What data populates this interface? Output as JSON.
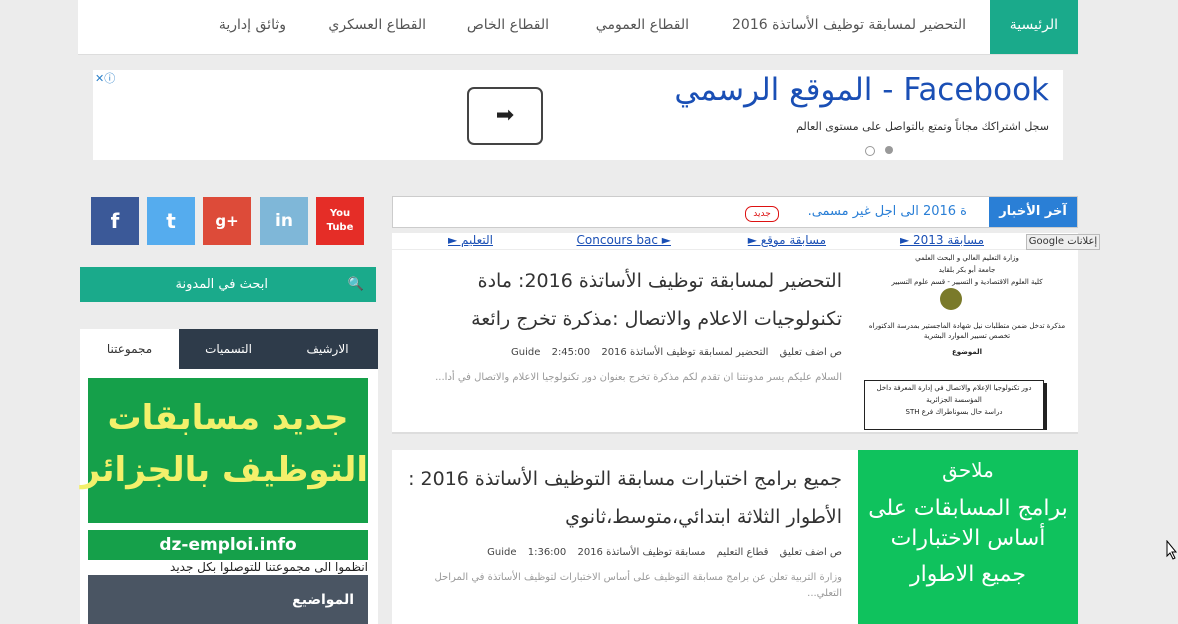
{
  "nav": {
    "home": "الرئيسية",
    "items": [
      "التحضير لمسابقة توظيف الأساتذة 2016",
      "القطاع العمومي",
      "القطاع الخاص",
      "القطاع العسكري",
      "وثائق إدارية"
    ]
  },
  "ad": {
    "title": "Facebook - الموقع الرسمي",
    "subtitle": "سجل اشتراكك مجاناً وتمتع بالتواصل على مستوى العالم",
    "arrow": "➡"
  },
  "social": {
    "facebook": "f",
    "twitter": "t",
    "gplus": "g+",
    "linkedin": "in",
    "youtube": "You Tube"
  },
  "search": {
    "label": "ابحث في المدونة"
  },
  "tabs": {
    "group": "مجموعتنا",
    "labels": "التسميات",
    "archive": "الارشيف"
  },
  "sidebar": {
    "image_line1": "جديد مسابقات",
    "image_line2": "التوظيف بالجزائر",
    "url": "dz-emploi.info",
    "join": "انظموا الى مجموعتنا للتوصلوا بكل جديد",
    "topics": "المواضيع"
  },
  "news": {
    "label": "آخر الأخبار",
    "text": "ة 2016 الى اجل غير مسمى.",
    "badge": "جديد"
  },
  "links": [
    "مسابقة 2013 ►",
    "مسابقة موقع ►",
    "Concours bac ►",
    "التعليم ►"
  ],
  "google_label": "Google إعلانات",
  "posts": [
    {
      "title": "التحضير لمسابقة توظيف الأساتذة 2016: مادة تكنولوجيات الاعلام والاتصال :مذكرة تخرج رائعة",
      "comment": "ص اضف تعليق",
      "category": "التحضير لمسابقة توظيف الأساتذة 2016",
      "time": "2:45:00",
      "author": "Guide",
      "excerpt": "السلام عليكم يسر مدونتنا ان تقدم لكم مذكرة تخرج بعنوان دور تكنولوجيا الاعلام والاتصال في أدا...",
      "thumb_lines": [
        "وزارة التعليم العالي و البحث العلمي",
        "جامعة أبو بكر بلقايد",
        "كلية العلوم الاقتصادية و التسيير - قسم علوم التسيير",
        "مذكرة تدخل ضمن متطلبات نيل شهادة الماجستير بمدرسة الدكتوراه",
        "تخصص تسيير الموارد البشرية",
        "الموضوع",
        "دور تكنولوجيا الإعلام والاتصال في إدارة المعرفة داخل",
        "المؤسسة الجزائرية",
        "دراسة حال بسوناطراك فرع STH"
      ]
    },
    {
      "title": "جميع برامج اختبارات مسابقة التوظيف الأساتذة 2016 : الأطوار الثلاثة ابتدائي،متوسط،ثانوي",
      "comment": "ص اضف تعليق",
      "category": "قطاع التعليم",
      "category2": "مسابقة توظيف الأساتذة 2016",
      "time": "1:36:00",
      "author": "Guide",
      "excerpt": "وزارة التربية تعلن عن برامج مسابقة التوظيف على أساس الاختبارات لتوظيف الأساتذة في المراحل التعلي...",
      "thumb_lines": [
        "ملاحق",
        "برامج المسابقات على",
        "أساس الاختبارات",
        "جميع الاطوار"
      ]
    }
  ],
  "colors": {
    "accent": "#1aaa8b",
    "navy": "#2e3b4a",
    "news": "#2a7fd6",
    "green": "#15a04a"
  }
}
